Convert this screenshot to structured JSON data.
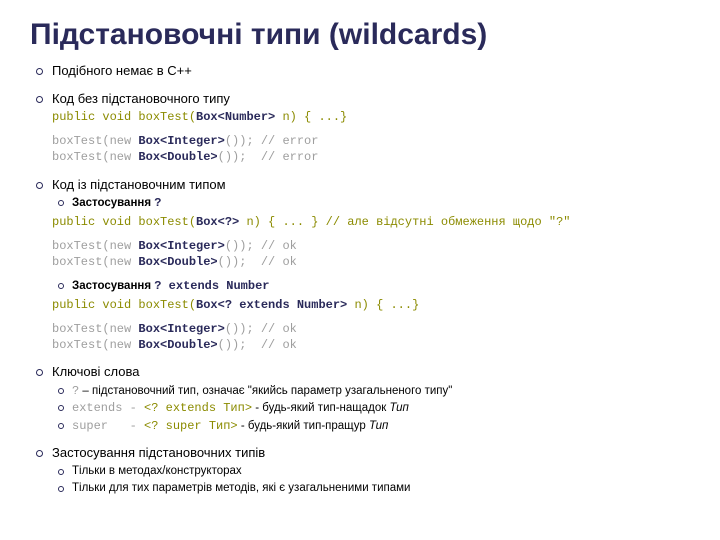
{
  "title": "Підстановочні типи (wildcards)",
  "b1": {
    "title": "Подібного немає в C++"
  },
  "b2": {
    "title": "Код без підстановочного типу",
    "sig_pre": "public void boxTest(",
    "sig_type": "Box<Number>",
    "sig_post": " n) { ...}",
    "call1_pre": "boxTest(new ",
    "call1_type": "Box<Integer>",
    "call1_post": "()); // error",
    "call2_pre": "boxTest(new ",
    "call2_type": "Box<Double>",
    "call2_post": "());  // error"
  },
  "b3": {
    "title": "Код із підстановочним типом",
    "app1_pre": "Застосування ",
    "app1_k": "?",
    "sig1_pre": "public void boxTest(",
    "sig1_type": "Box<?>",
    "sig1_post": " n) { ... } // але відсутні обмеження щодо \"?\"",
    "c1_pre": "boxTest(new ",
    "c1_type": "Box<Integer>",
    "c1_post": "()); // ok",
    "c2_pre": "boxTest(new ",
    "c2_type": "Box<Double>",
    "c2_post": "());  // ok",
    "app2_pre": "Застосування ",
    "app2_k": "? extends Number",
    "sig2_pre": "public void boxTest(",
    "sig2_type": "Box<? extends Number>",
    "sig2_post": " n) { ...}",
    "c3_pre": "boxTest(new ",
    "c3_type": "Box<Integer>",
    "c3_post": "()); // ok",
    "c4_pre": "boxTest(new ",
    "c4_type": "Box<Double>",
    "c4_post": "());  // ok"
  },
  "b4": {
    "title": "Ключові слова",
    "k1_code": "?",
    "k1_text": " – підстановочний тип, означає \"якийсь параметр узагальненого типу\"",
    "k2_code": "extends - ",
    "k2_syntax": "<? extends Тип>",
    "k2_text": " - будь-який тип-нащадок ",
    "k2_em": "Тип",
    "k3_code": "super   - ",
    "k3_syntax": "<? super Тип>",
    "k3_text": " - будь-який тип-пращур ",
    "k3_em": "Тип"
  },
  "b5": {
    "title": "Застосування підстановочних типів",
    "i1": "Тільки в методах/конструкторах",
    "i2": "Тільки для тих параметрів методів, які є узагальненими типами"
  }
}
